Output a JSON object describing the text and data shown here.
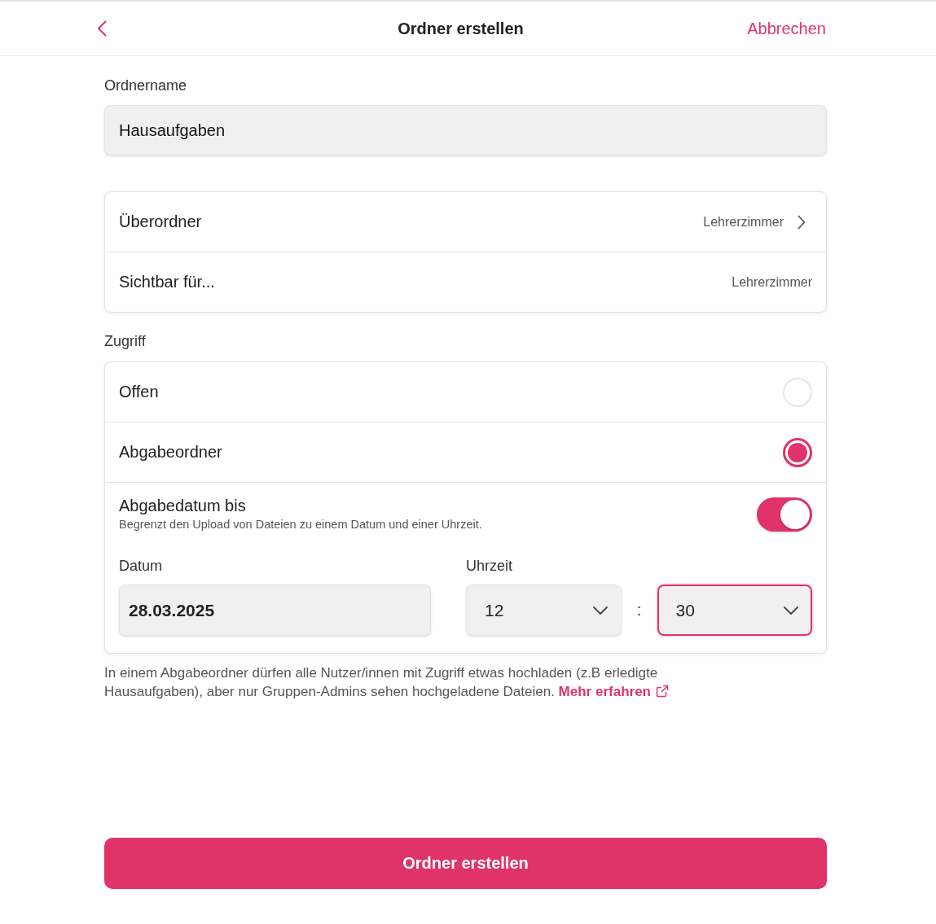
{
  "header": {
    "title": "Ordner erstellen",
    "cancel": "Abbrechen"
  },
  "name_field": {
    "label": "Ordnername",
    "value": "Hausaufgaben"
  },
  "location_rows": [
    {
      "kind": "link",
      "label": "Überordner",
      "value": "Lehrerzimmer"
    },
    {
      "kind": "static",
      "label": "Sichtbar für...",
      "value": "Lehrerzimmer"
    }
  ],
  "access": {
    "label": "Zugriff",
    "options": [
      {
        "label": "Offen",
        "selected": false
      },
      {
        "label": "Abgabeordner",
        "selected": true
      }
    ],
    "deadline": {
      "title": "Abgabedatum bis",
      "description": "Begrenzt den Upload von Dateien zu einem Datum und einer Uhrzeit.",
      "on": true,
      "date": {
        "label": "Datum",
        "value": "28.03.2025"
      },
      "time": {
        "label": "Uhrzeit",
        "hour": {
          "value": "12",
          "focused": false
        },
        "separator": ":",
        "minute": {
          "value": "30",
          "focused": true
        }
      }
    }
  },
  "info": {
    "text": "In einem Abgabeordner dürfen alle Nutzer/innen mit Zugriff etwas hochladen (z.B erledigte Hausaufgaben), aber nur Gruppen-Admins sehen hochgeladene Dateien.",
    "link": "Mehr erfahren"
  },
  "submit_button": "Ordner erstellen"
}
